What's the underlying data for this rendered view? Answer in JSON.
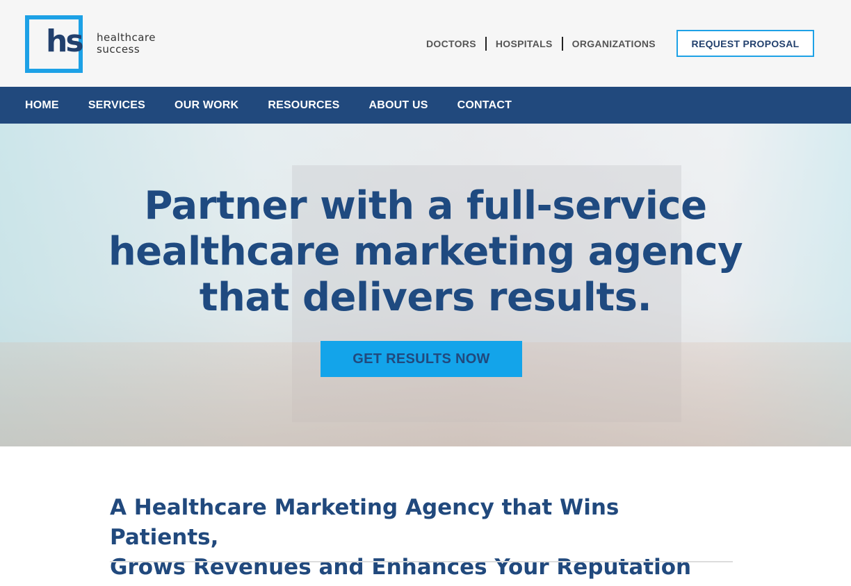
{
  "brand": {
    "mark": "hs",
    "name_line1": "healthcare",
    "name_line2": "success"
  },
  "utility_nav": {
    "items": [
      "DOCTORS",
      "HOSPITALS",
      "ORGANIZATIONS"
    ],
    "request_proposal": "REQUEST PROPOSAL"
  },
  "main_nav": {
    "items": [
      "HOME",
      "SERVICES",
      "OUR WORK",
      "RESOURCES",
      "ABOUT US",
      "CONTACT"
    ]
  },
  "hero": {
    "headline_lines": [
      "Partner with a full-service",
      "healthcare marketing agency",
      "that delivers results."
    ],
    "cta_label": "GET RESULTS NOW"
  },
  "intro": {
    "heading_lines": [
      "A Healthcare Marketing Agency that Wins Patients,",
      "Grows Revenues and Enhances Your Reputation"
    ]
  },
  "colors": {
    "primary_navy": "#21497d",
    "accent_blue": "#13a4ea"
  }
}
